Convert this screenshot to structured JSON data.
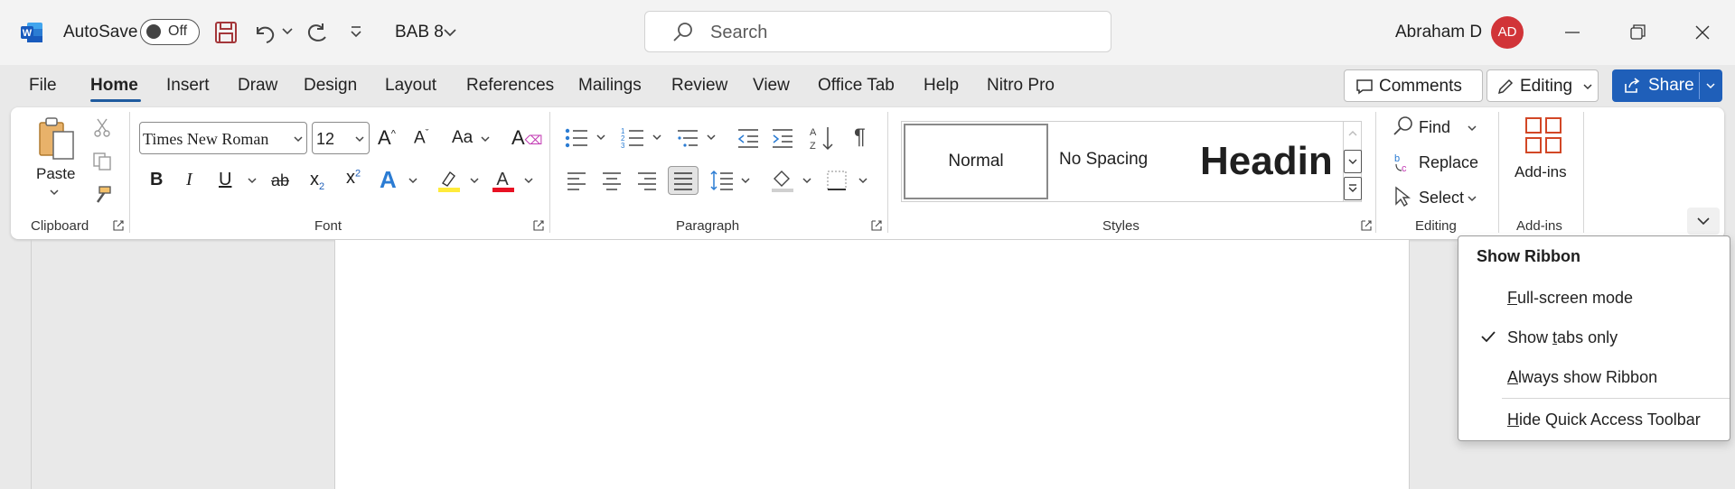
{
  "titlebar": {
    "autosave_label": "AutoSave",
    "autosave_state": "Off",
    "doc_name": "BAB 8",
    "search_placeholder": "Search",
    "user_name": "Abraham D",
    "avatar_initials": "AD"
  },
  "tabs": [
    "File",
    "Home",
    "Insert",
    "Draw",
    "Design",
    "Layout",
    "References",
    "Mailings",
    "Review",
    "View",
    "Office Tab",
    "Help",
    "Nitro Pro"
  ],
  "active_tab": "Home",
  "actions": {
    "comments": "Comments",
    "editing": "Editing",
    "share": "Share"
  },
  "ribbon": {
    "clipboard": {
      "paste": "Paste",
      "label": "Clipboard"
    },
    "font": {
      "name": "Times New Roman",
      "size": "12",
      "label": "Font",
      "case": "Aa"
    },
    "paragraph": {
      "label": "Paragraph"
    },
    "styles": {
      "normal": "Normal",
      "no_spacing": "No Spacing",
      "heading": "Heading",
      "label": "Styles"
    },
    "editing": {
      "find": "Find",
      "replace": "Replace",
      "select": "Select",
      "label": "Editing"
    },
    "addins": {
      "button": "Add-ins",
      "label": "Add-ins"
    }
  },
  "menu": {
    "title": "Show Ribbon",
    "items": [
      {
        "pre": "",
        "u": "F",
        "post": "ull-screen mode",
        "checked": false
      },
      {
        "pre": "Show ",
        "u": "t",
        "post": "abs only",
        "checked": true
      },
      {
        "pre": "",
        "u": "A",
        "post": "lways show Ribbon",
        "checked": false
      },
      {
        "pre": "",
        "u": "H",
        "post": "ide Quick Access Toolbar",
        "checked": false
      }
    ]
  },
  "colors": {
    "accent": "#1f5fb9",
    "avatar": "#d13438",
    "highlight": "#ffeb3b",
    "font_color": "#e81123"
  }
}
